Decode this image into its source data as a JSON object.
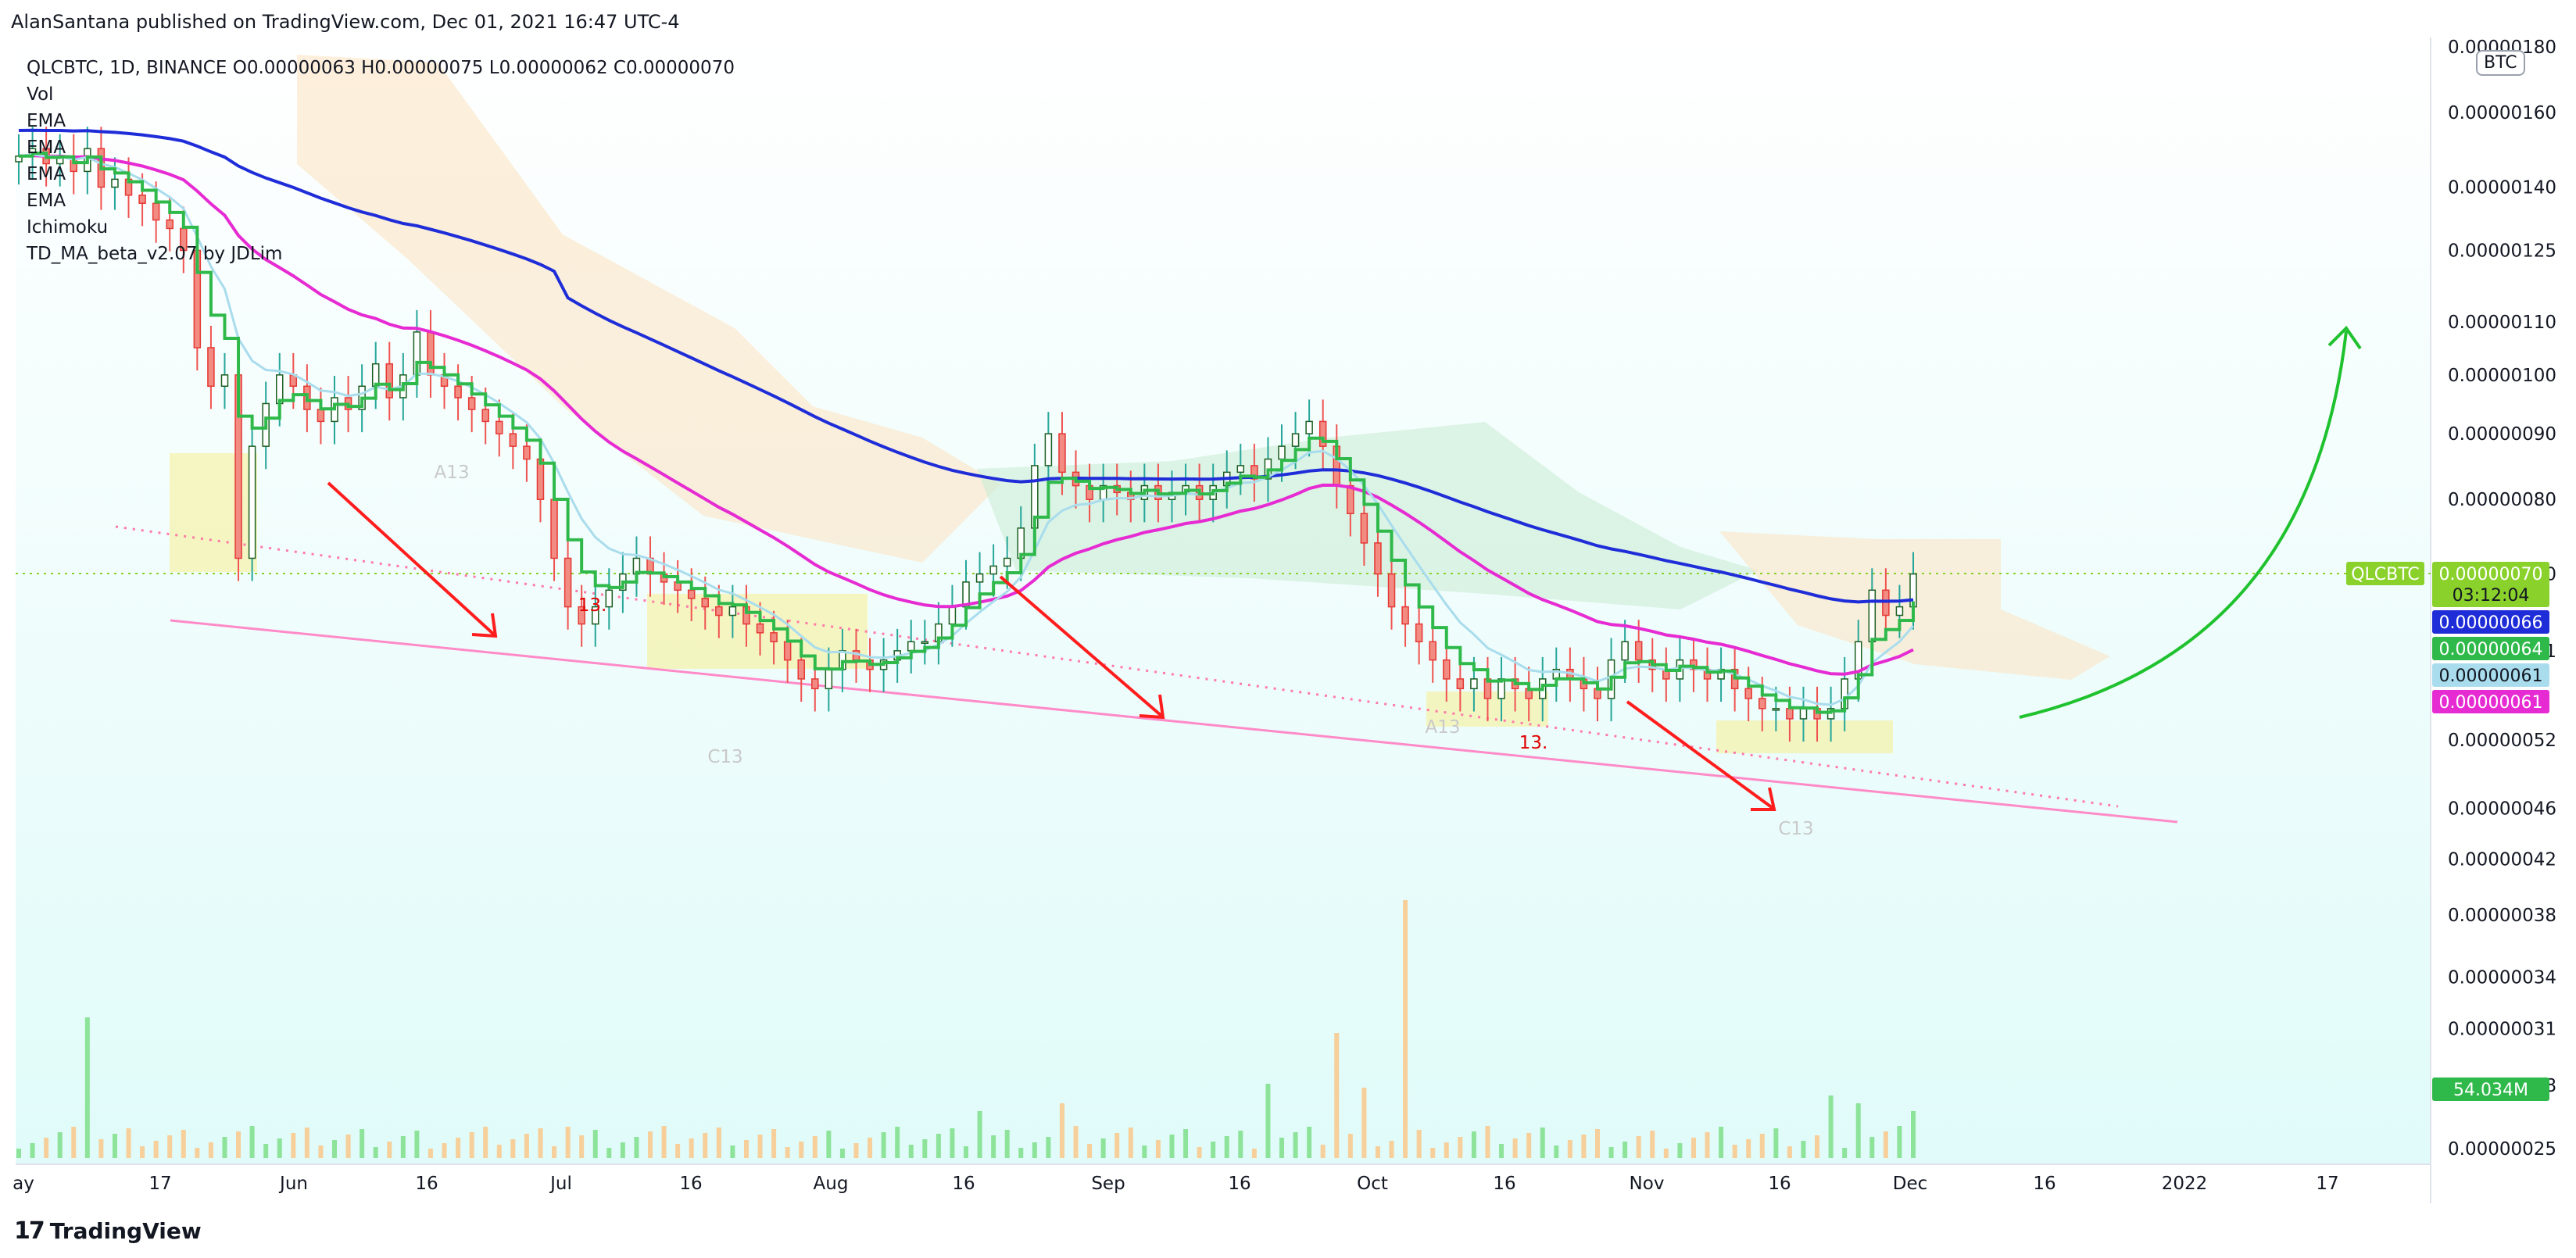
{
  "caption": "AlanSantana published on TradingView.com, Dec 01, 2021 16:47 UTC-4",
  "brand": "TradingView",
  "currency_badge": "BTC",
  "legend": {
    "symbol_line": "QLCBTC, 1D, BINANCE  O0.00000063  H0.00000075  L0.00000062  C0.00000070",
    "indicators": [
      "Vol",
      "EMA",
      "EMA",
      "EMA",
      "EMA",
      "Ichimoku",
      "TD_MA_beta_v2.07 by JDLim"
    ]
  },
  "price_labels": [
    {
      "text": "QLCBTC",
      "color": "#8ad12c"
    },
    {
      "text": "0.00000070",
      "color": "#8ad12c",
      "sub": "03:12:04"
    },
    {
      "text": "0.00000066",
      "color": "#1f2dd8"
    },
    {
      "text": "0.00000064",
      "color": "#2fb94a"
    },
    {
      "text": "0.00000061",
      "color": "#a9dcec"
    },
    {
      "text": "0.00000061",
      "color": "#e62bd2"
    },
    {
      "text": "54.034M",
      "color": "#2fb94a"
    }
  ],
  "annotations": [
    "A13",
    "13.",
    "C13",
    "A13",
    "13.",
    "C13"
  ],
  "chart_data": {
    "type": "candlestick",
    "title": "QLCBTC, 1D, BINANCE",
    "y_scale": "log",
    "ylim": [
      2.5e-07,
      1.8e-06
    ],
    "y_ticks": [
      "0.00000180",
      "0.00000160",
      "0.00000140",
      "0.00000125",
      "0.00000110",
      "0.00000100",
      "0.00000090",
      "0.00000080",
      "0.00000070",
      "0.00000061",
      "0.00000052",
      "0.00000046",
      "0.00000042",
      "0.00000038",
      "0.00000034",
      "0.00000031",
      "0.00000028",
      "0.00000025"
    ],
    "x_ticks": [
      "ay",
      "17",
      "Jun",
      "16",
      "Jul",
      "16",
      "Aug",
      "16",
      "Sep",
      "16",
      "Oct",
      "16",
      "Nov",
      "16",
      "Dec",
      "16",
      "2022",
      "17"
    ],
    "last_ohlc": {
      "open": 6.3e-07,
      "high": 7.5e-07,
      "low": 6.2e-07,
      "close": 7e-07
    },
    "close_series": [
      1.48e-06,
      1.5e-06,
      1.46e-06,
      1.48e-06,
      1.44e-06,
      1.5e-06,
      1.4e-06,
      1.42e-06,
      1.38e-06,
      1.36e-06,
      1.32e-06,
      1.3e-06,
      1.25e-06,
      1.05e-06,
      9.8e-07,
      1e-06,
      7.2e-07,
      8.8e-07,
      9.5e-07,
      1e-06,
      9.8e-07,
      9.4e-07,
      9.2e-07,
      9.6e-07,
      9.4e-07,
      9.8e-07,
      1.02e-06,
      9.6e-07,
      1e-06,
      1.08e-06,
      1e-06,
      9.8e-07,
      9.6e-07,
      9.4e-07,
      9.2e-07,
      9e-07,
      8.8e-07,
      8.6e-07,
      8e-07,
      7.2e-07,
      6.6e-07,
      6.4e-07,
      6.6e-07,
      6.8e-07,
      7e-07,
      7.2e-07,
      7e-07,
      6.9e-07,
      6.8e-07,
      6.7e-07,
      6.6e-07,
      6.5e-07,
      6.6e-07,
      6.4e-07,
      6.3e-07,
      6.2e-07,
      6e-07,
      5.8e-07,
      5.7e-07,
      5.9e-07,
      6.1e-07,
      6e-07,
      5.9e-07,
      6e-07,
      6.1e-07,
      6.2e-07,
      6.2e-07,
      6.4e-07,
      6.6e-07,
      6.9e-07,
      7e-07,
      7.1e-07,
      7.2e-07,
      7.6e-07,
      8.5e-07,
      9e-07,
      8.4e-07,
      8.2e-07,
      8e-07,
      8.2e-07,
      8.1e-07,
      8e-07,
      8.2e-07,
      8e-07,
      8.1e-07,
      8.2e-07,
      8e-07,
      8.2e-07,
      8.4e-07,
      8.5e-07,
      8.3e-07,
      8.6e-07,
      8.8e-07,
      9e-07,
      9.2e-07,
      8.8e-07,
      8.2e-07,
      7.8e-07,
      7.4e-07,
      7e-07,
      6.6e-07,
      6.4e-07,
      6.2e-07,
      6e-07,
      5.8e-07,
      5.7e-07,
      5.8e-07,
      5.6e-07,
      5.8e-07,
      5.7e-07,
      5.6e-07,
      5.8e-07,
      5.9e-07,
      5.8e-07,
      5.7e-07,
      5.6e-07,
      6e-07,
      6.2e-07,
      6e-07,
      5.9e-07,
      5.8e-07,
      6e-07,
      5.9e-07,
      5.8e-07,
      5.9e-07,
      5.7e-07,
      5.6e-07,
      5.5e-07,
      5.5e-07,
      5.4e-07,
      5.5e-07,
      5.4e-07,
      5.5e-07,
      5.8e-07,
      6.2e-07,
      6.8e-07,
      6.5e-07,
      6.6e-07,
      7e-07
    ],
    "volume_label": "54.034M"
  }
}
